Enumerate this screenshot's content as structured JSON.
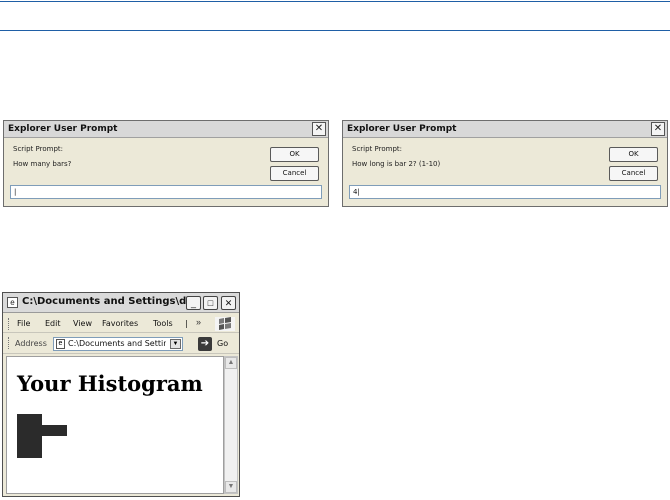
{
  "dialogs": [
    {
      "title": "Explorer User Prompt",
      "label": "Script Prompt:",
      "question": "How many bars?",
      "ok": "OK",
      "cancel": "Cancel",
      "input_value": "|"
    },
    {
      "title": "Explorer User Prompt",
      "label": "Script Prompt:",
      "question": "How long is bar 2? (1-10)",
      "ok": "OK",
      "cancel": "Cancel",
      "input_value": "4|"
    }
  ],
  "browser": {
    "title": "C:\\Documents and Settings\\d...",
    "window_buttons": {
      "minimize": "_",
      "maximize": "□",
      "close": "✕"
    },
    "menu": [
      "File",
      "Edit",
      "View",
      "Favorites",
      "Tools",
      "|"
    ],
    "menu_more": "»",
    "address_label": "Address",
    "address_value": "C:\\Documents and Settings\\",
    "go_label": "Go",
    "page_heading": "Your Histogram",
    "histogram_bars": [
      2,
      4,
      2,
      2
    ]
  }
}
